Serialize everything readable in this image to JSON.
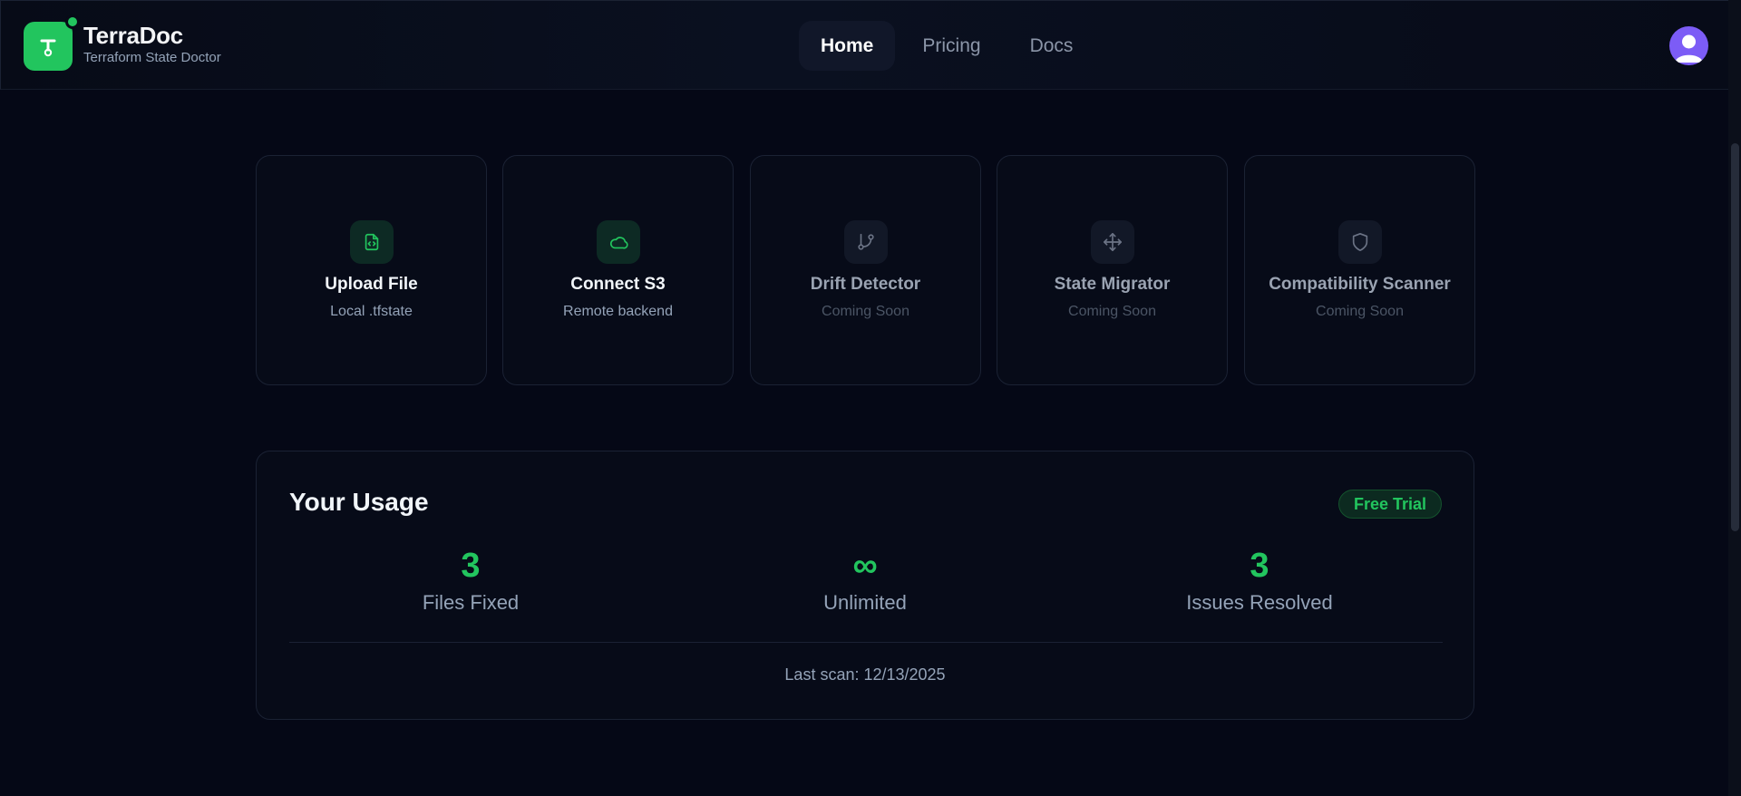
{
  "brand": {
    "name": "TerraDoc",
    "subtitle": "Terraform State Doctor",
    "logo_glyph": "terraform-t-icon",
    "accent_color": "#22c55e"
  },
  "nav": {
    "items": [
      {
        "label": "Home",
        "active": true
      },
      {
        "label": "Pricing",
        "active": false
      },
      {
        "label": "Docs",
        "active": false
      }
    ]
  },
  "user": {
    "avatar_icon": "user-avatar-icon",
    "avatar_color": "#7c5cf6"
  },
  "cards": [
    {
      "title": "Upload File",
      "subtitle": "Local .tfstate",
      "icon": "file-code-icon",
      "enabled": true
    },
    {
      "title": "Connect S3",
      "subtitle": "Remote backend",
      "icon": "cloud-icon",
      "enabled": true
    },
    {
      "title": "Drift Detector",
      "subtitle": "Coming Soon",
      "icon": "git-branch-icon",
      "enabled": false
    },
    {
      "title": "State Migrator",
      "subtitle": "Coming Soon",
      "icon": "move-icon",
      "enabled": false
    },
    {
      "title": "Compatibility Scanner",
      "subtitle": "Coming Soon",
      "icon": "shield-icon",
      "enabled": false
    }
  ],
  "usage": {
    "title": "Your Usage",
    "badge": "Free Trial",
    "stats": [
      {
        "value": "3",
        "label": "Files Fixed"
      },
      {
        "value": "∞",
        "label": "Unlimited"
      },
      {
        "value": "3",
        "label": "Issues Resolved"
      }
    ],
    "last_scan": "Last scan: 12/13/2025"
  }
}
